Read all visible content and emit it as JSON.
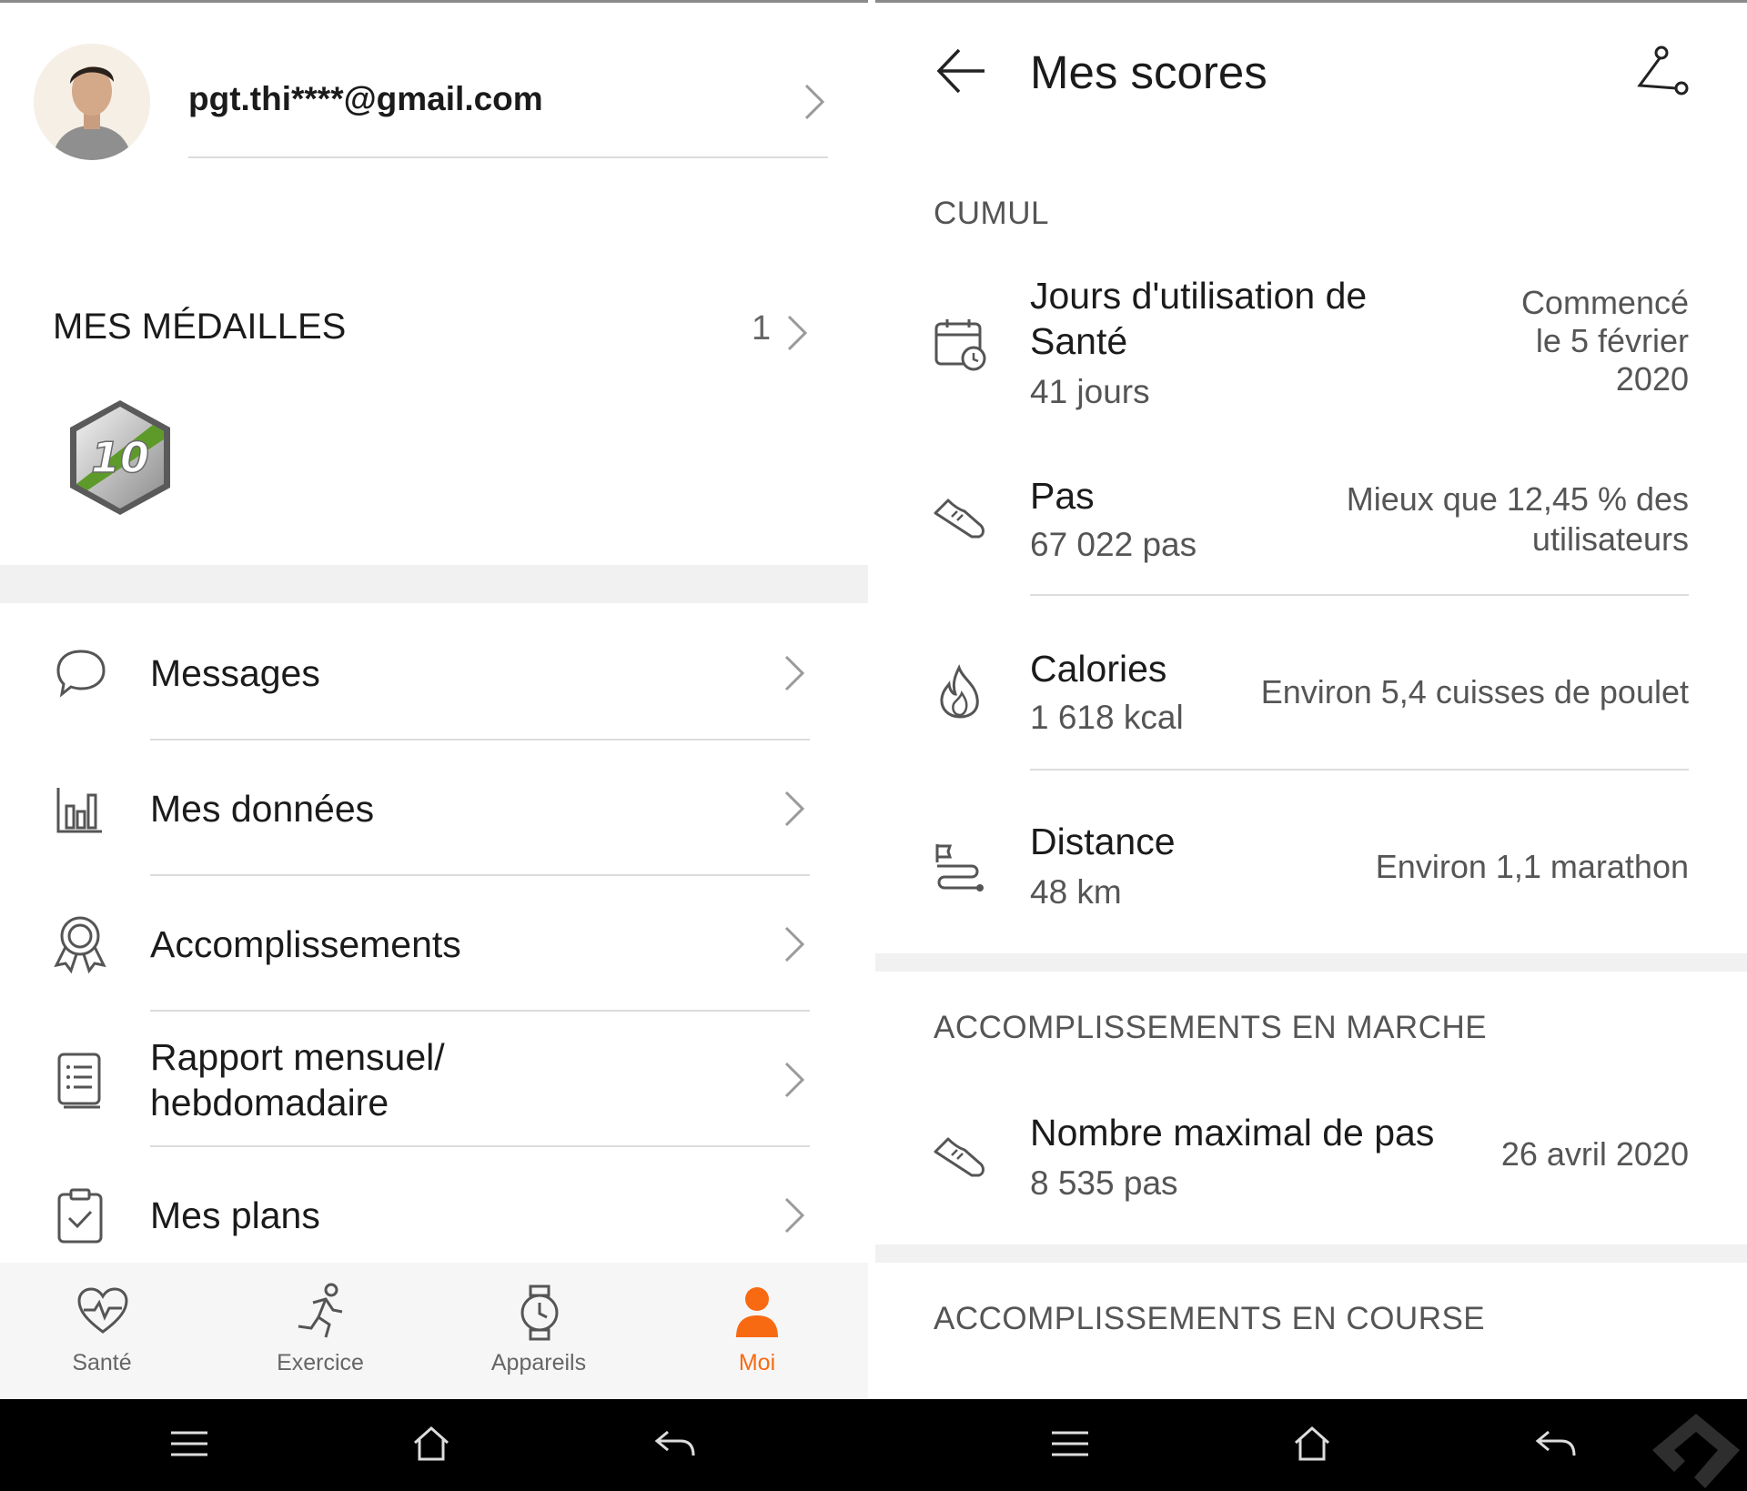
{
  "profile": {
    "email": "pgt.thi****@gmail.com"
  },
  "medals": {
    "heading": "MES MÉDAILLES",
    "count": "1",
    "badge_text": "10"
  },
  "menu": [
    {
      "label": "Messages",
      "icon": "chat-bubble-icon"
    },
    {
      "label": "Mes données",
      "icon": "bar-chart-icon"
    },
    {
      "label": "Accomplissements",
      "icon": "award-icon"
    },
    {
      "label": "Rapport mensuel/",
      "label2": "hebdomadaire",
      "icon": "report-icon"
    },
    {
      "label": "Mes plans",
      "icon": "clipboard-check-icon"
    }
  ],
  "bottom_tabs": [
    {
      "label": "Santé",
      "icon": "heart-pulse-icon"
    },
    {
      "label": "Exercice",
      "icon": "running-icon"
    },
    {
      "label": "Appareils",
      "icon": "watch-icon"
    },
    {
      "label": "Moi",
      "icon": "person-icon",
      "active": true
    }
  ],
  "scores": {
    "title": "Mes scores",
    "cumul_heading": "CUMUL",
    "items": [
      {
        "title_line1": "Jours d'utilisation de",
        "title_line2": "Santé",
        "value": "41 jours",
        "note_line1": "Commencé",
        "note_line2": "le 5 février",
        "note_line3": "2020",
        "icon": "calendar-clock-icon"
      },
      {
        "title": "Pas",
        "value": "67 022 pas",
        "note_line1": "Mieux que 12,45 % des",
        "note_line2": "utilisateurs",
        "icon": "shoe-icon"
      },
      {
        "title": "Calories",
        "value": "1 618 kcal",
        "note": "Environ 5,4 cuisses de poulet",
        "icon": "flame-icon"
      },
      {
        "title": "Distance",
        "value": "48 km",
        "note": "Environ 1,1 marathon",
        "icon": "route-flag-icon"
      }
    ],
    "walking_heading": "ACCOMPLISSEMENTS EN MARCHE",
    "walking_item": {
      "title": "Nombre maximal de pas",
      "value": "8 535 pas",
      "note": "26 avril 2020",
      "icon": "shoe-icon"
    },
    "running_heading": "ACCOMPLISSEMENTS EN COURSE"
  },
  "colors": {
    "accent": "#F86A12",
    "text": "#1b1b1b",
    "secondary": "#555555",
    "divider": "#dcdcdc"
  }
}
